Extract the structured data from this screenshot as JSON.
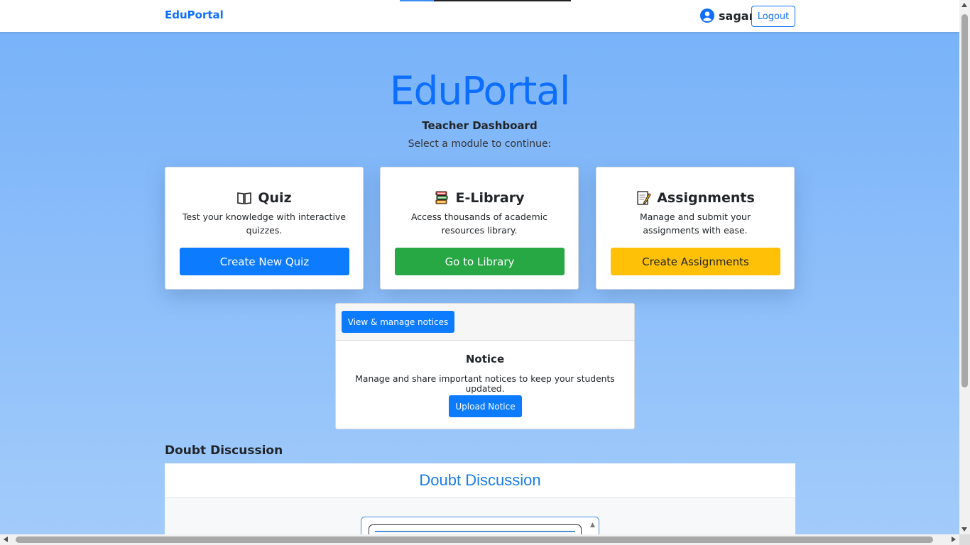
{
  "navbar": {
    "brand": "EduPortal",
    "username": "sagar",
    "logout_label": "Logout",
    "user_icon": "user-circle-icon",
    "loading_progress": 0.2
  },
  "hero": {
    "title": "EduPortal",
    "subtitle": "Teacher Dashboard",
    "instruction": "Select a module to continue:"
  },
  "modules": [
    {
      "icon": "open-book-icon",
      "title": "Quiz",
      "description": "Test your knowledge with interactive quizzes.",
      "button": "Create New Quiz",
      "button_color": "#0d7bfd"
    },
    {
      "icon": "books-icon",
      "title": "E-Library",
      "description": "Access thousands of academic resources library.",
      "button": "Go to Library",
      "button_color": "#28a745"
    },
    {
      "icon": "memo-icon",
      "title": "Assignments",
      "description": "Manage and submit your assignments with ease.",
      "button": "Create Assignments",
      "button_color": "#ffc107"
    }
  ],
  "notice": {
    "manage_button": "View & manage notices",
    "title": "Notice",
    "description": "Manage and share important notices to keep your students updated.",
    "upload_button": "Upload Notice"
  },
  "doubt": {
    "section_heading": "Doubt Discussion",
    "panel_title": "Doubt Discussion"
  },
  "colors": {
    "primary": "#0d6efd",
    "background_top": "#76b1f9",
    "background_bottom": "#a2cbfa"
  }
}
